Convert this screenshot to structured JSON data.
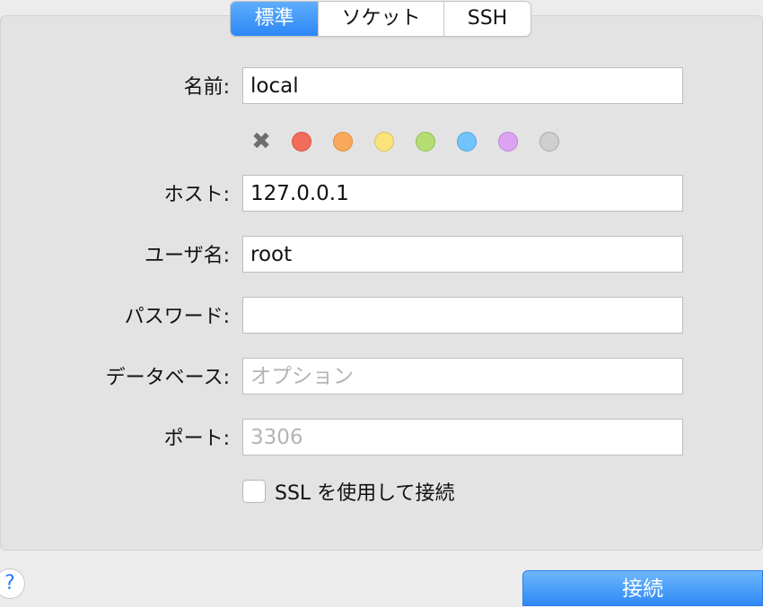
{
  "tabs": [
    {
      "label": "標準",
      "active": true
    },
    {
      "label": "ソケット",
      "active": false
    },
    {
      "label": "SSH",
      "active": false
    }
  ],
  "form": {
    "name": {
      "label": "名前:",
      "value": "local"
    },
    "host": {
      "label": "ホスト:",
      "value": "127.0.0.1"
    },
    "user": {
      "label": "ユーザ名:",
      "value": "root"
    },
    "password": {
      "label": "パスワード:",
      "value": ""
    },
    "database": {
      "label": "データベース:",
      "value": "",
      "placeholder": "オプション"
    },
    "port": {
      "label": "ポート:",
      "value": "",
      "placeholder": "3306"
    }
  },
  "colors": {
    "clear_icon": "x-icon",
    "swatches": [
      {
        "name": "red",
        "fill": "#f26b5b",
        "stroke": "#d9503f"
      },
      {
        "name": "orange",
        "fill": "#f9a95b",
        "stroke": "#e08c3c"
      },
      {
        "name": "yellow",
        "fill": "#f9e37a",
        "stroke": "#d9c35a"
      },
      {
        "name": "green",
        "fill": "#b4de73",
        "stroke": "#93bf52"
      },
      {
        "name": "blue",
        "fill": "#72c3fb",
        "stroke": "#4fa5e0"
      },
      {
        "name": "purple",
        "fill": "#dba3f0",
        "stroke": "#bb83d4"
      },
      {
        "name": "gray",
        "fill": "#cfcfcf",
        "stroke": "#a9a9a9"
      }
    ]
  },
  "ssl": {
    "label": "SSL を使用して接続",
    "checked": false
  },
  "footer": {
    "help_label": "?",
    "connect_label": "接続"
  },
  "accent_color": "#2d87f6"
}
